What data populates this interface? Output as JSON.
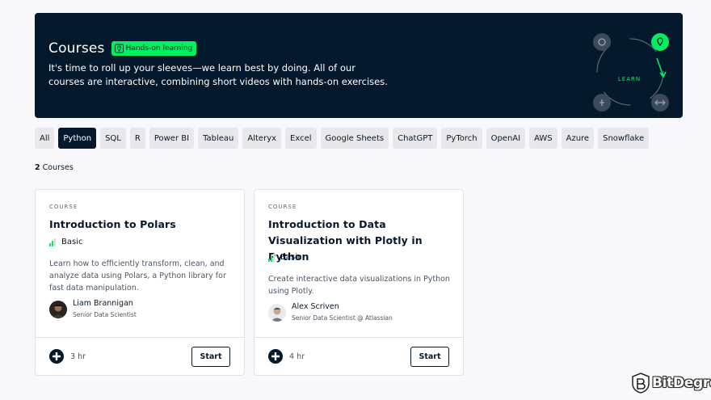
{
  "hero": {
    "title": "Courses",
    "badge": "Hands-on learning",
    "description": "It's time to roll up your sleeves—we learn best by doing. All of our courses are interactive, combining short videos with hands-on exercises.",
    "cycle_label": "LEARN"
  },
  "filters": [
    "All",
    "Python",
    "SQL",
    "R",
    "Power BI",
    "Tableau",
    "Alteryx",
    "Excel",
    "Google Sheets",
    "ChatGPT",
    "PyTorch",
    "OpenAI",
    "AWS",
    "Azure",
    "Snowflake"
  ],
  "active_filter": "Python",
  "results": {
    "count": "2",
    "label": "Courses"
  },
  "cards": [
    {
      "kind": "COURSE",
      "title": "Introduction to Polars",
      "level": "Basic",
      "description": "Learn how to efficiently transform, clean, and analyze data using Polars, a Python library for fast data manipulation.",
      "author_name": "Liam Brannigan",
      "author_role": "Senior Data Scientist",
      "duration": "3 hr",
      "button": "Start"
    },
    {
      "kind": "COURSE",
      "title": "Introduction to Data Visualization with Plotly in Python",
      "level": "Basic",
      "description": "Create interactive data visualizations in Python using Plotly.",
      "author_name": "Alex Scriven",
      "author_role": "Senior Data Scientist @ Atlassian",
      "duration": "4 hr",
      "button": "Start"
    }
  ],
  "watermark": "BitDegree",
  "colors": {
    "navy": "#05192d",
    "green": "#03ef62",
    "chip": "#e8e8ea"
  }
}
